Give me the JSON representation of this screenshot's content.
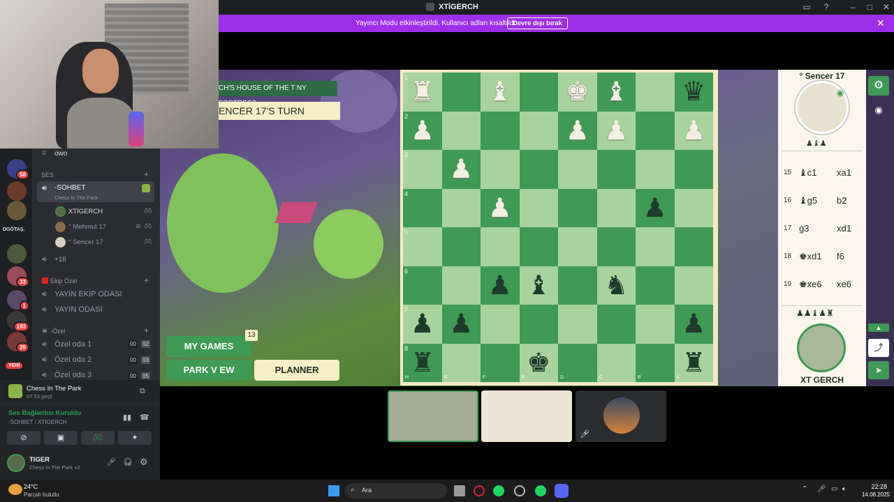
{
  "window": {
    "title": "XTİGERCH"
  },
  "banner": {
    "message": "Yayıncı Modu etkinleştirildi. Kullanıcı adları kısaltıldı.",
    "button": "Devre dışı bırak"
  },
  "sidebar": {
    "top_channel": "owo",
    "voice_category": "SES",
    "voice_channel": {
      "name": "-SOHBET",
      "activity": "Chess In The Park"
    },
    "voice_users": [
      "XTİGERCH",
      "° Mehmut 17",
      "° Sencer 17"
    ],
    "more_users": "+18",
    "ekip_category": "Ekip Özel",
    "ekip_channels": [
      "YAYIN EKİP ODASI",
      "YAYIN ODASI"
    ],
    "ozel_category": "-Özel",
    "ozel_channels": [
      {
        "name": "Özel oda 1",
        "c1": "00",
        "c2": "02"
      },
      {
        "name": "Özel oda 2",
        "c1": "00",
        "c2": "03"
      },
      {
        "name": "Özel oda 3",
        "c1": "00",
        "c2": "05"
      }
    ],
    "server_label": "DGÖTAŞ.",
    "server_badges": [
      "58",
      "33",
      "1",
      "193",
      "29"
    ],
    "new_label": "YENİ"
  },
  "activity": {
    "game": "Chess In The Park",
    "time": "07:33 geçti"
  },
  "voice_status": {
    "status": "Ses Bağlantısı Kuruldu",
    "channel": "-SOHBET / XTİGERCH"
  },
  "user_panel": {
    "name": "TIGER",
    "status": "Chess In The Park +2"
  },
  "game": {
    "location": "CH'S HOUSE OF THE T NY FORTRESS",
    "turn": "ENCER 17'S TURN",
    "my_games": "MY GAMES",
    "my_games_count": "13",
    "park_view": "PARK V EW",
    "planner": "PLANNER",
    "ranks": [
      "1",
      "2",
      "3",
      "4",
      "5",
      "6",
      "7",
      "8"
    ],
    "files": [
      "H",
      "G",
      "F",
      "E",
      "D",
      "C",
      "B",
      "A"
    ],
    "pieces": [
      {
        "s": "♜",
        "r": 0,
        "f": 0,
        "c": "w"
      },
      {
        "s": "♝",
        "r": 0,
        "f": 2,
        "c": "w"
      },
      {
        "s": "♚",
        "r": 0,
        "f": 4,
        "c": "w"
      },
      {
        "s": "♝",
        "r": 0,
        "f": 5,
        "c": "w"
      },
      {
        "s": "♛",
        "r": 0,
        "f": 7,
        "c": "b"
      },
      {
        "s": "♟",
        "r": 1,
        "f": 0,
        "c": "w"
      },
      {
        "s": "♟",
        "r": 1,
        "f": 4,
        "c": "w"
      },
      {
        "s": "♟",
        "r": 1,
        "f": 5,
        "c": "w"
      },
      {
        "s": "♟",
        "r": 1,
        "f": 7,
        "c": "w"
      },
      {
        "s": "♟",
        "r": 2,
        "f": 1,
        "c": "w"
      },
      {
        "s": "♟",
        "r": 3,
        "f": 2,
        "c": "w"
      },
      {
        "s": "♟",
        "r": 3,
        "f": 6,
        "c": "b"
      },
      {
        "s": "♟",
        "r": 5,
        "f": 2,
        "c": "b"
      },
      {
        "s": "♝",
        "r": 5,
        "f": 3,
        "c": "b"
      },
      {
        "s": "♞",
        "r": 5,
        "f": 5,
        "c": "b"
      },
      {
        "s": "♟",
        "r": 6,
        "f": 0,
        "c": "b"
      },
      {
        "s": "♟",
        "r": 6,
        "f": 1,
        "c": "b"
      },
      {
        "s": "♟",
        "r": 6,
        "f": 7,
        "c": "b"
      },
      {
        "s": "♜",
        "r": 7,
        "f": 0,
        "c": "b"
      },
      {
        "s": "♚",
        "r": 7,
        "f": 3,
        "c": "b"
      },
      {
        "s": "♜",
        "r": 7,
        "f": 7,
        "c": "b"
      }
    ],
    "opponent": "° Sencer 17",
    "player": "XT GERCH",
    "moves": [
      {
        "n": "15",
        "w": "♝c1",
        "b": "xa1"
      },
      {
        "n": "16",
        "w": "♝g5",
        "b": "b2"
      },
      {
        "n": "17",
        "w": "g3",
        "b": "xd1"
      },
      {
        "n": "18",
        "w": "♚xd1",
        "b": "f6"
      },
      {
        "n": "19",
        "w": "♚xe6",
        "b": "xe6"
      }
    ]
  },
  "taskbar": {
    "weather_temp": "24°C",
    "weather_desc": "Parçalı bulutlu",
    "search": "Ara",
    "time": "22:28",
    "date": "14.08.2025"
  }
}
